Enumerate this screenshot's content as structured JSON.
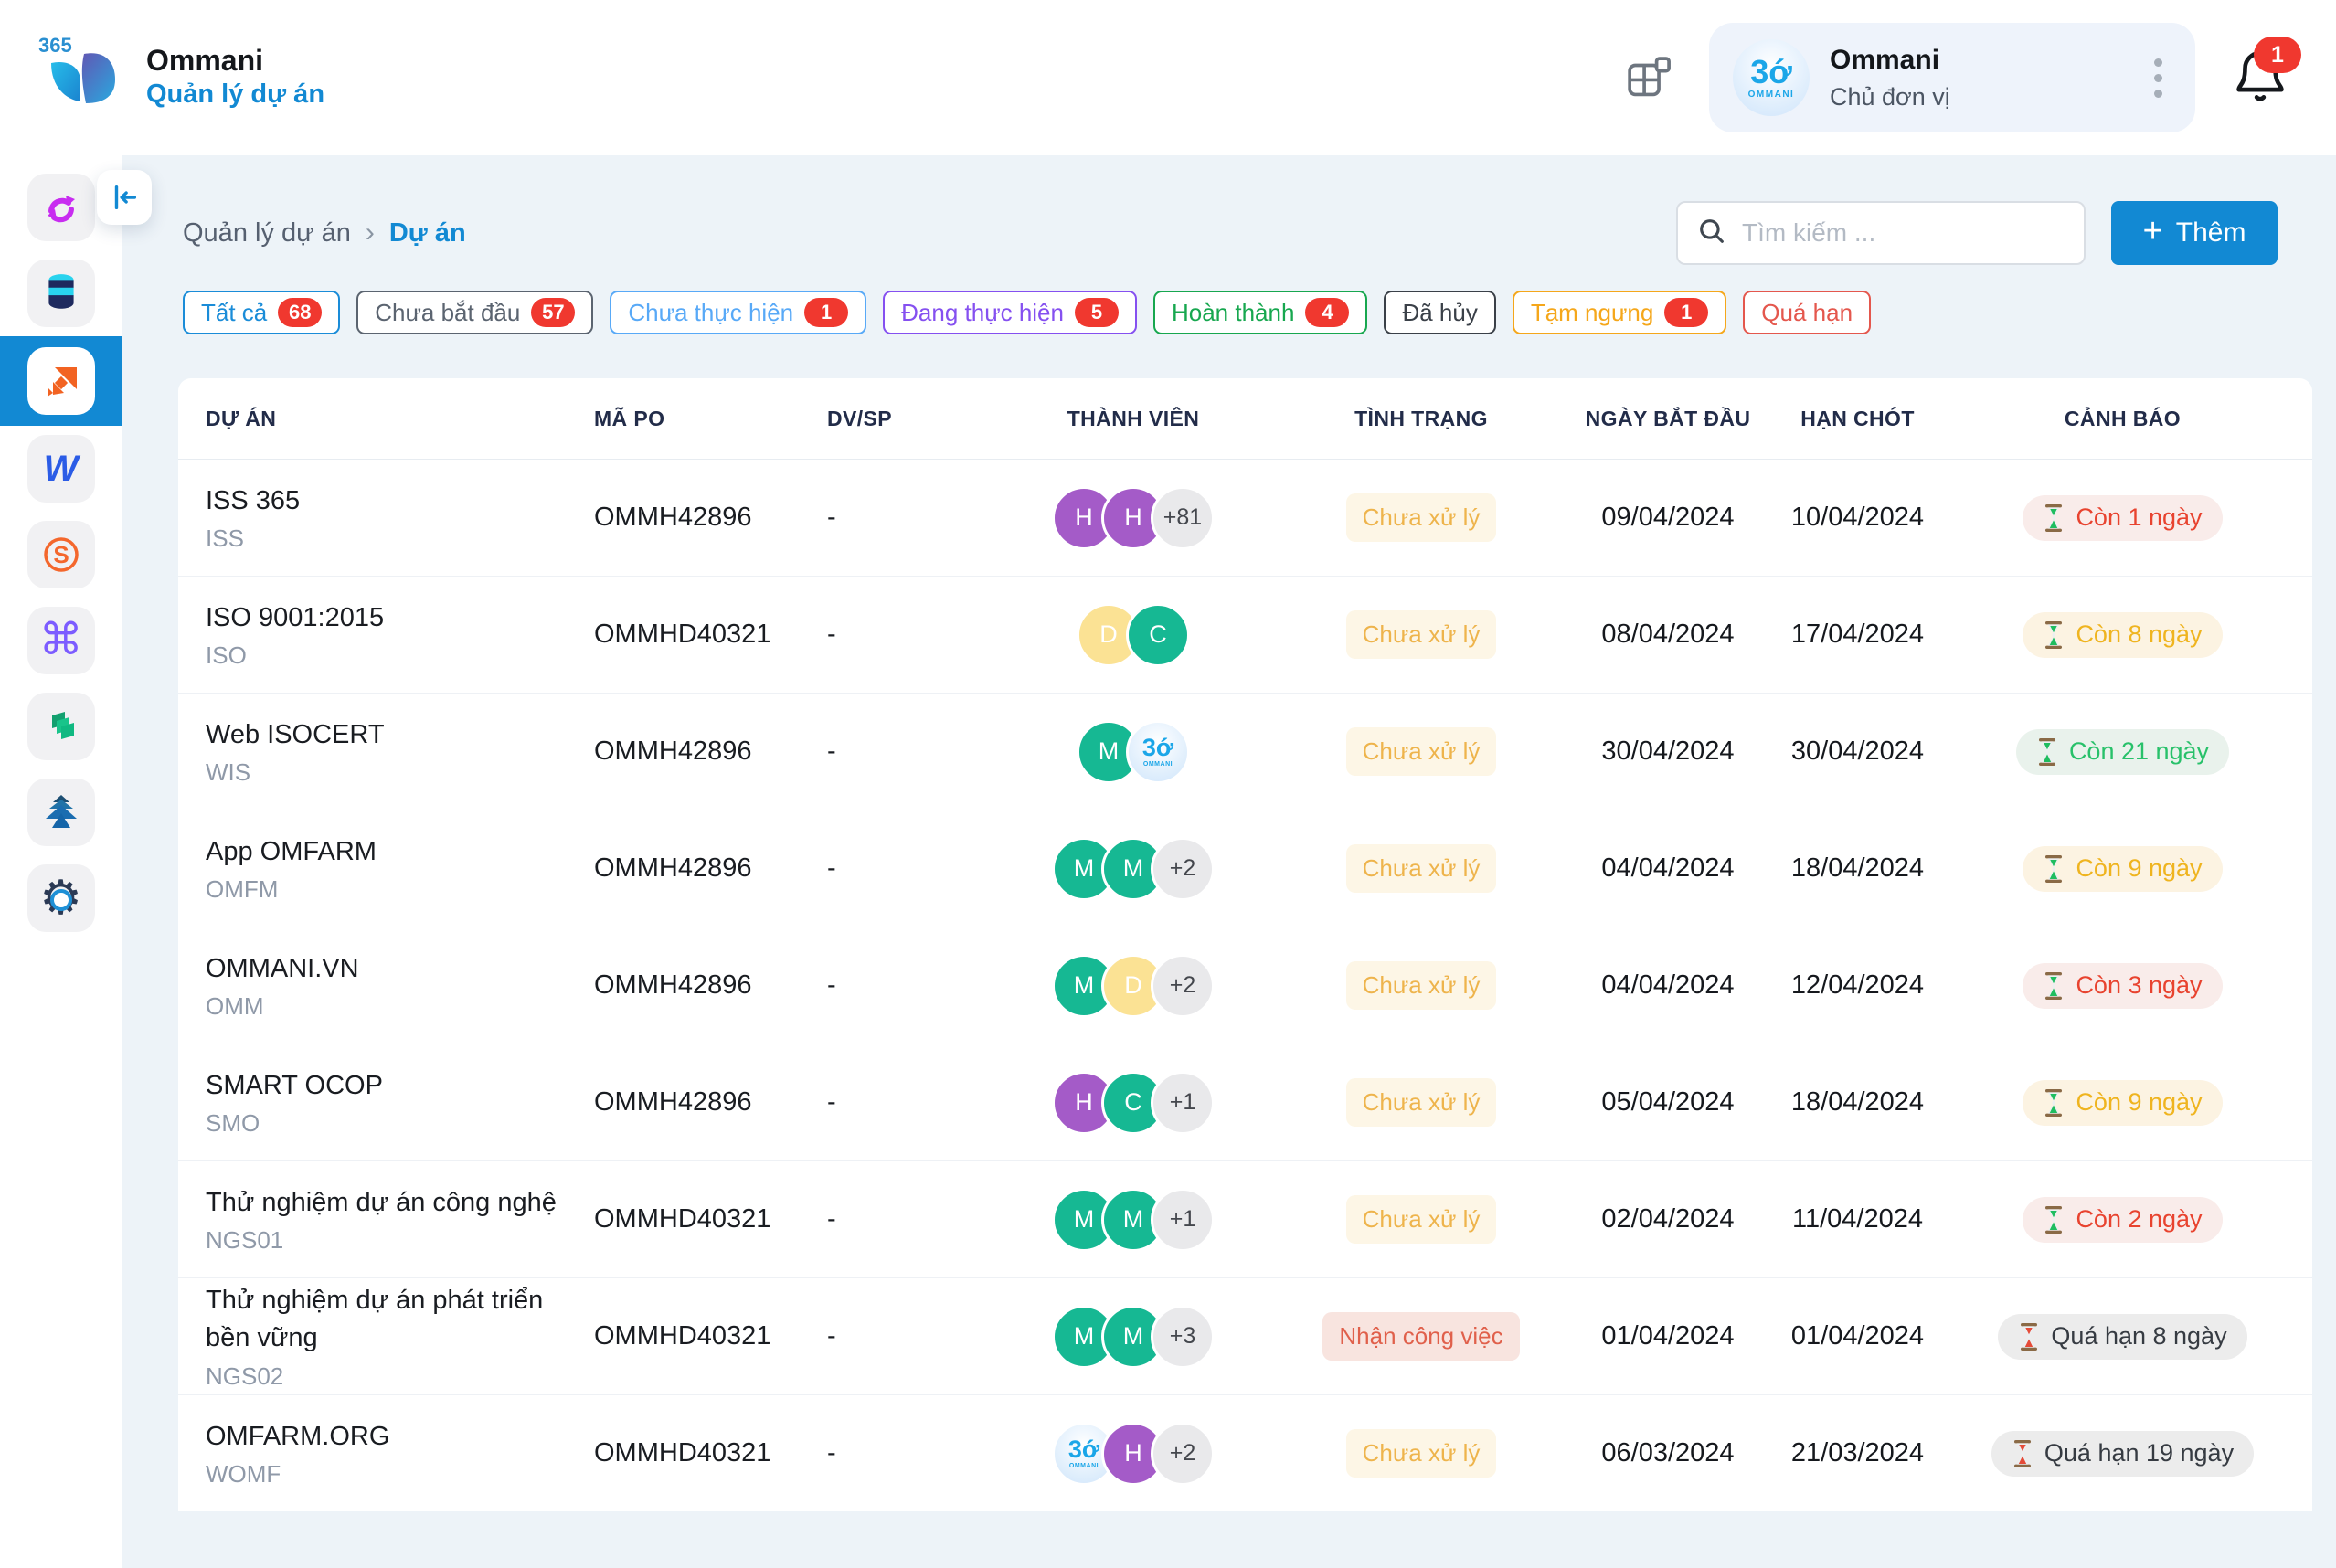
{
  "header": {
    "logo_badge": "365",
    "app_title": "Ommani",
    "app_subtitle": "Quản lý dự án",
    "user": {
      "name": "Ommani",
      "role": "Chủ đơn vị",
      "avatar_text": "3ớ",
      "avatar_subtext": "OMMANI"
    },
    "notification_count": "1"
  },
  "sidebar": {
    "items": [
      {
        "id": "sync-app",
        "active": false
      },
      {
        "id": "database-app",
        "active": false
      },
      {
        "id": "projects-app",
        "active": true
      },
      {
        "id": "w-app",
        "active": false
      },
      {
        "id": "s-app",
        "active": false
      },
      {
        "id": "clover-app",
        "active": false
      },
      {
        "id": "layers-app",
        "active": false
      },
      {
        "id": "tree-app",
        "active": false
      },
      {
        "id": "settings-app",
        "active": false
      }
    ]
  },
  "breadcrumb": {
    "parent": "Quản lý dự án",
    "current": "Dự án"
  },
  "toolbar": {
    "search_placeholder": "Tìm kiếm ...",
    "add_label": "Thêm",
    "add_plus": "+"
  },
  "filters": [
    {
      "label": "Tất cả",
      "count": "68",
      "color": "#1a8cd8"
    },
    {
      "label": "Chưa bắt đầu",
      "count": "57",
      "color": "#5b6470"
    },
    {
      "label": "Chưa thực hiện",
      "count": "1",
      "color": "#58a9f7"
    },
    {
      "label": "Đang thực hiện",
      "count": "5",
      "color": "#8550f0"
    },
    {
      "label": "Hoàn thành",
      "count": "4",
      "color": "#17a74f"
    },
    {
      "label": "Đã hủy",
      "count": null,
      "color": "#3a4048"
    },
    {
      "label": "Tạm ngưng",
      "count": "1",
      "color": "#f5a71b"
    },
    {
      "label": "Quá hạn",
      "count": null,
      "color": "#e4574d"
    }
  ],
  "table": {
    "columns": [
      "DỰ ÁN",
      "MÃ PO",
      "DV/SP",
      "THÀNH VIÊN",
      "TÌNH TRẠNG",
      "NGÀY BẮT ĐẦU",
      "HẠN CHÓT",
      "CẢNH BÁO"
    ],
    "rows": [
      {
        "name": "ISS 365",
        "code": "ISS",
        "po": "OMMH42896",
        "dvsp": "-",
        "members": [
          {
            "t": "H",
            "c": "purple"
          },
          {
            "t": "H",
            "c": "purple"
          },
          {
            "t": "+81",
            "c": "more"
          }
        ],
        "status": {
          "label": "Chưa xử lý",
          "type": "pending"
        },
        "start": "09/04/2024",
        "deadline": "10/04/2024",
        "warning": {
          "label": "Còn 1 ngày",
          "type": "danger"
        }
      },
      {
        "name": "ISO 9001:2015",
        "code": "ISO",
        "po": "OMMHD40321",
        "dvsp": "-",
        "members": [
          {
            "t": "D",
            "c": "yellow"
          },
          {
            "t": "C",
            "c": "green"
          }
        ],
        "status": {
          "label": "Chưa xử lý",
          "type": "pending"
        },
        "start": "08/04/2024",
        "deadline": "17/04/2024",
        "warning": {
          "label": "Còn 8 ngày",
          "type": "warn"
        }
      },
      {
        "name": "Web ISOCERT",
        "code": "WIS",
        "po": "OMMH42896",
        "dvsp": "-",
        "members": [
          {
            "t": "M",
            "c": "green"
          },
          {
            "t": "",
            "c": "logo"
          }
        ],
        "status": {
          "label": "Chưa xử lý",
          "type": "pending"
        },
        "start": "30/04/2024",
        "deadline": "30/04/2024",
        "warning": {
          "label": "Còn 21 ngày",
          "type": "ok"
        }
      },
      {
        "name": "App OMFARM",
        "code": "OMFM",
        "po": "OMMH42896",
        "dvsp": "-",
        "members": [
          {
            "t": "M",
            "c": "green"
          },
          {
            "t": "M",
            "c": "green"
          },
          {
            "t": "+2",
            "c": "more"
          }
        ],
        "status": {
          "label": "Chưa xử lý",
          "type": "pending"
        },
        "start": "04/04/2024",
        "deadline": "18/04/2024",
        "warning": {
          "label": "Còn 9 ngày",
          "type": "warn"
        }
      },
      {
        "name": "OMMANI.VN",
        "code": "OMM",
        "po": "OMMH42896",
        "dvsp": "-",
        "members": [
          {
            "t": "M",
            "c": "green"
          },
          {
            "t": "D",
            "c": "yellow"
          },
          {
            "t": "+2",
            "c": "more"
          }
        ],
        "status": {
          "label": "Chưa xử lý",
          "type": "pending"
        },
        "start": "04/04/2024",
        "deadline": "12/04/2024",
        "warning": {
          "label": "Còn 3 ngày",
          "type": "danger"
        }
      },
      {
        "name": "SMART OCOP",
        "code": "SMO",
        "po": "OMMH42896",
        "dvsp": "-",
        "members": [
          {
            "t": "H",
            "c": "purple"
          },
          {
            "t": "C",
            "c": "green"
          },
          {
            "t": "+1",
            "c": "more"
          }
        ],
        "status": {
          "label": "Chưa xử lý",
          "type": "pending"
        },
        "start": "05/04/2024",
        "deadline": "18/04/2024",
        "warning": {
          "label": "Còn 9 ngày",
          "type": "warn"
        }
      },
      {
        "name": "Thử nghiệm dự án công nghệ",
        "code": "NGS01",
        "po": "OMMHD40321",
        "dvsp": "-",
        "members": [
          {
            "t": "M",
            "c": "green"
          },
          {
            "t": "M",
            "c": "green"
          },
          {
            "t": "+1",
            "c": "more"
          }
        ],
        "status": {
          "label": "Chưa xử lý",
          "type": "pending"
        },
        "start": "02/04/2024",
        "deadline": "11/04/2024",
        "warning": {
          "label": "Còn 2 ngày",
          "type": "danger"
        }
      },
      {
        "name": "Thử nghiệm dự án phát triển bền vững",
        "code": "NGS02",
        "po": "OMMHD40321",
        "dvsp": "-",
        "members": [
          {
            "t": "M",
            "c": "green"
          },
          {
            "t": "M",
            "c": "green"
          },
          {
            "t": "+3",
            "c": "more"
          }
        ],
        "status": {
          "label": "Nhận công việc",
          "type": "accept"
        },
        "start": "01/04/2024",
        "deadline": "01/04/2024",
        "warning": {
          "label": "Quá hạn 8 ngày",
          "type": "overdue"
        }
      },
      {
        "name": "OMFARM.ORG",
        "code": "WOMF",
        "po": "OMMHD40321",
        "dvsp": "-",
        "members": [
          {
            "t": "",
            "c": "logo"
          },
          {
            "t": "H",
            "c": "purple"
          },
          {
            "t": "+2",
            "c": "more"
          }
        ],
        "status": {
          "label": "Chưa xử lý",
          "type": "pending"
        },
        "start": "06/03/2024",
        "deadline": "21/03/2024",
        "warning": {
          "label": "Quá hạn 19 ngày",
          "type": "overdue"
        }
      }
    ]
  },
  "styles": {
    "primary": "#1289d3",
    "avatar": {
      "purple": "#a45bc8",
      "green": "#16b893",
      "yellow": "#fbe294",
      "more": "#e9e9eb"
    },
    "status": {
      "pending": {
        "fg": "#eeb44c",
        "bg": "#fdf6e6"
      },
      "accept": {
        "fg": "#e0604b",
        "bg": "#f8e4df"
      }
    },
    "warning": {
      "danger": {
        "fg": "#e8432f",
        "bg": "#f9ecea",
        "sand": "#1fbd5f"
      },
      "warn": {
        "fg": "#efb41f",
        "bg": "#fcf3e2",
        "sand": "#1fbd5f"
      },
      "ok": {
        "fg": "#28c16a",
        "bg": "#e9f2ec",
        "sand": "#1fbd5f"
      },
      "overdue": {
        "fg": "#363b42",
        "bg": "#ececec",
        "sand": "#e54b38"
      }
    }
  }
}
